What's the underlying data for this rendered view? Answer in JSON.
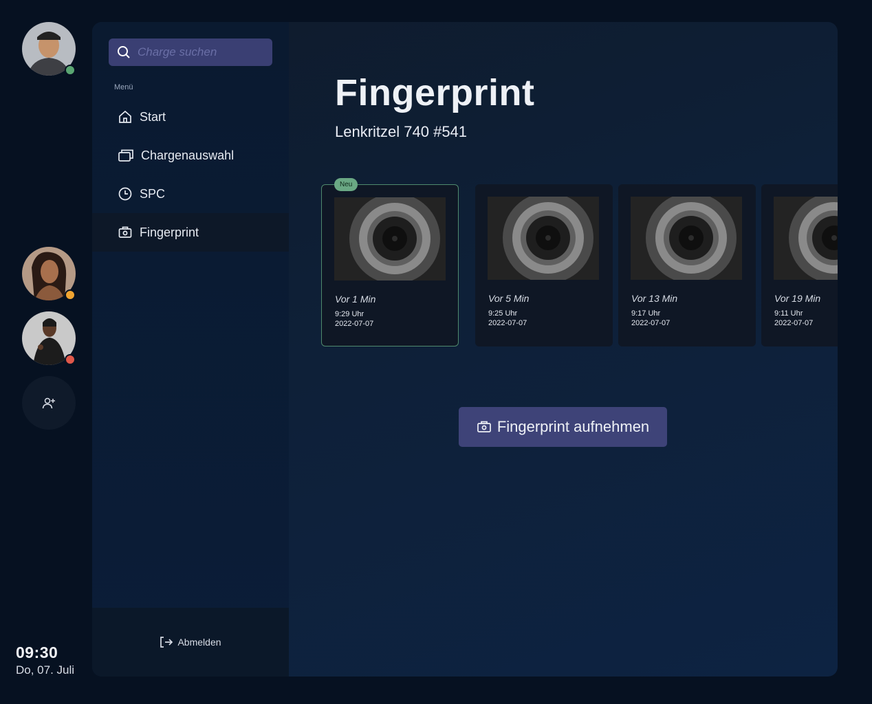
{
  "users": [
    {
      "name": "user-1",
      "status_color": "#5aa672"
    },
    {
      "name": "user-2",
      "status_color": "#f0a431"
    },
    {
      "name": "user-3",
      "status_color": "#e0584a"
    }
  ],
  "clock": {
    "time": "09:30",
    "date": "Do, 07. Juli"
  },
  "search": {
    "placeholder": "Charge suchen"
  },
  "sidebar": {
    "menu_label": "Menü",
    "items": [
      {
        "label": "Start",
        "icon": "home-icon"
      },
      {
        "label": "Chargenauswahl",
        "icon": "stack-icon"
      },
      {
        "label": "SPC",
        "icon": "clock-icon"
      },
      {
        "label": "Fingerprint",
        "icon": "camera-icon",
        "active": true
      }
    ],
    "logout_label": "Abmelden"
  },
  "main": {
    "title": "Fingerprint",
    "subtitle": "Lenkritzel 740 #541",
    "cards": [
      {
        "badge": "Neu",
        "ago": "Vor 1 Min",
        "time": "9:29 Uhr",
        "date": "2022-07-07",
        "selected": true
      },
      {
        "ago": "Vor 5 Min",
        "time": "9:25 Uhr",
        "date": "2022-07-07"
      },
      {
        "ago": "Vor 13 Min",
        "time": "9:17 Uhr",
        "date": "2022-07-07"
      },
      {
        "ago": "Vor 19 Min",
        "time": "9:11 Uhr",
        "date": "2022-07-07"
      }
    ],
    "capture_label": "Fingerprint aufnehmen"
  }
}
